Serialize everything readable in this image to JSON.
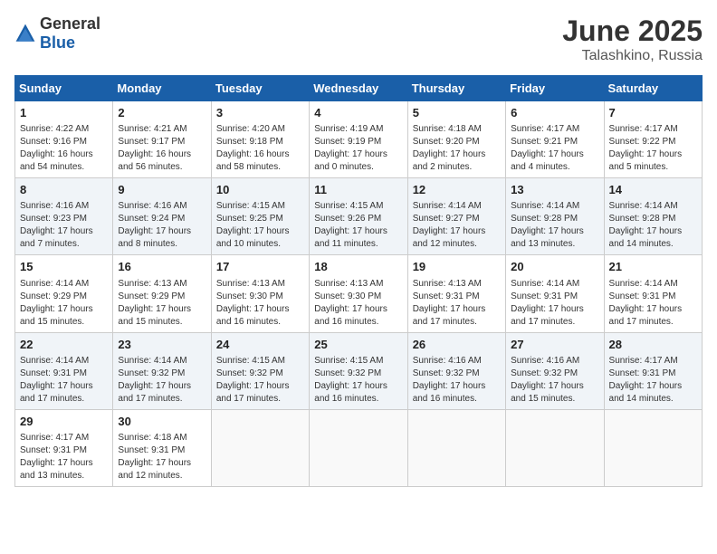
{
  "header": {
    "logo_general": "General",
    "logo_blue": "Blue",
    "title": "June 2025",
    "location": "Talashkino, Russia"
  },
  "calendar": {
    "days_of_week": [
      "Sunday",
      "Monday",
      "Tuesday",
      "Wednesday",
      "Thursday",
      "Friday",
      "Saturday"
    ],
    "weeks": [
      [
        {
          "day": "1",
          "info": "Sunrise: 4:22 AM\nSunset: 9:16 PM\nDaylight: 16 hours\nand 54 minutes."
        },
        {
          "day": "2",
          "info": "Sunrise: 4:21 AM\nSunset: 9:17 PM\nDaylight: 16 hours\nand 56 minutes."
        },
        {
          "day": "3",
          "info": "Sunrise: 4:20 AM\nSunset: 9:18 PM\nDaylight: 16 hours\nand 58 minutes."
        },
        {
          "day": "4",
          "info": "Sunrise: 4:19 AM\nSunset: 9:19 PM\nDaylight: 17 hours\nand 0 minutes."
        },
        {
          "day": "5",
          "info": "Sunrise: 4:18 AM\nSunset: 9:20 PM\nDaylight: 17 hours\nand 2 minutes."
        },
        {
          "day": "6",
          "info": "Sunrise: 4:17 AM\nSunset: 9:21 PM\nDaylight: 17 hours\nand 4 minutes."
        },
        {
          "day": "7",
          "info": "Sunrise: 4:17 AM\nSunset: 9:22 PM\nDaylight: 17 hours\nand 5 minutes."
        }
      ],
      [
        {
          "day": "8",
          "info": "Sunrise: 4:16 AM\nSunset: 9:23 PM\nDaylight: 17 hours\nand 7 minutes."
        },
        {
          "day": "9",
          "info": "Sunrise: 4:16 AM\nSunset: 9:24 PM\nDaylight: 17 hours\nand 8 minutes."
        },
        {
          "day": "10",
          "info": "Sunrise: 4:15 AM\nSunset: 9:25 PM\nDaylight: 17 hours\nand 10 minutes."
        },
        {
          "day": "11",
          "info": "Sunrise: 4:15 AM\nSunset: 9:26 PM\nDaylight: 17 hours\nand 11 minutes."
        },
        {
          "day": "12",
          "info": "Sunrise: 4:14 AM\nSunset: 9:27 PM\nDaylight: 17 hours\nand 12 minutes."
        },
        {
          "day": "13",
          "info": "Sunrise: 4:14 AM\nSunset: 9:28 PM\nDaylight: 17 hours\nand 13 minutes."
        },
        {
          "day": "14",
          "info": "Sunrise: 4:14 AM\nSunset: 9:28 PM\nDaylight: 17 hours\nand 14 minutes."
        }
      ],
      [
        {
          "day": "15",
          "info": "Sunrise: 4:14 AM\nSunset: 9:29 PM\nDaylight: 17 hours\nand 15 minutes."
        },
        {
          "day": "16",
          "info": "Sunrise: 4:13 AM\nSunset: 9:29 PM\nDaylight: 17 hours\nand 15 minutes."
        },
        {
          "day": "17",
          "info": "Sunrise: 4:13 AM\nSunset: 9:30 PM\nDaylight: 17 hours\nand 16 minutes."
        },
        {
          "day": "18",
          "info": "Sunrise: 4:13 AM\nSunset: 9:30 PM\nDaylight: 17 hours\nand 16 minutes."
        },
        {
          "day": "19",
          "info": "Sunrise: 4:13 AM\nSunset: 9:31 PM\nDaylight: 17 hours\nand 17 minutes."
        },
        {
          "day": "20",
          "info": "Sunrise: 4:14 AM\nSunset: 9:31 PM\nDaylight: 17 hours\nand 17 minutes."
        },
        {
          "day": "21",
          "info": "Sunrise: 4:14 AM\nSunset: 9:31 PM\nDaylight: 17 hours\nand 17 minutes."
        }
      ],
      [
        {
          "day": "22",
          "info": "Sunrise: 4:14 AM\nSunset: 9:31 PM\nDaylight: 17 hours\nand 17 minutes."
        },
        {
          "day": "23",
          "info": "Sunrise: 4:14 AM\nSunset: 9:32 PM\nDaylight: 17 hours\nand 17 minutes."
        },
        {
          "day": "24",
          "info": "Sunrise: 4:15 AM\nSunset: 9:32 PM\nDaylight: 17 hours\nand 17 minutes."
        },
        {
          "day": "25",
          "info": "Sunrise: 4:15 AM\nSunset: 9:32 PM\nDaylight: 17 hours\nand 16 minutes."
        },
        {
          "day": "26",
          "info": "Sunrise: 4:16 AM\nSunset: 9:32 PM\nDaylight: 17 hours\nand 16 minutes."
        },
        {
          "day": "27",
          "info": "Sunrise: 4:16 AM\nSunset: 9:32 PM\nDaylight: 17 hours\nand 15 minutes."
        },
        {
          "day": "28",
          "info": "Sunrise: 4:17 AM\nSunset: 9:31 PM\nDaylight: 17 hours\nand 14 minutes."
        }
      ],
      [
        {
          "day": "29",
          "info": "Sunrise: 4:17 AM\nSunset: 9:31 PM\nDaylight: 17 hours\nand 13 minutes."
        },
        {
          "day": "30",
          "info": "Sunrise: 4:18 AM\nSunset: 9:31 PM\nDaylight: 17 hours\nand 12 minutes."
        },
        {
          "day": "",
          "info": ""
        },
        {
          "day": "",
          "info": ""
        },
        {
          "day": "",
          "info": ""
        },
        {
          "day": "",
          "info": ""
        },
        {
          "day": "",
          "info": ""
        }
      ]
    ]
  }
}
